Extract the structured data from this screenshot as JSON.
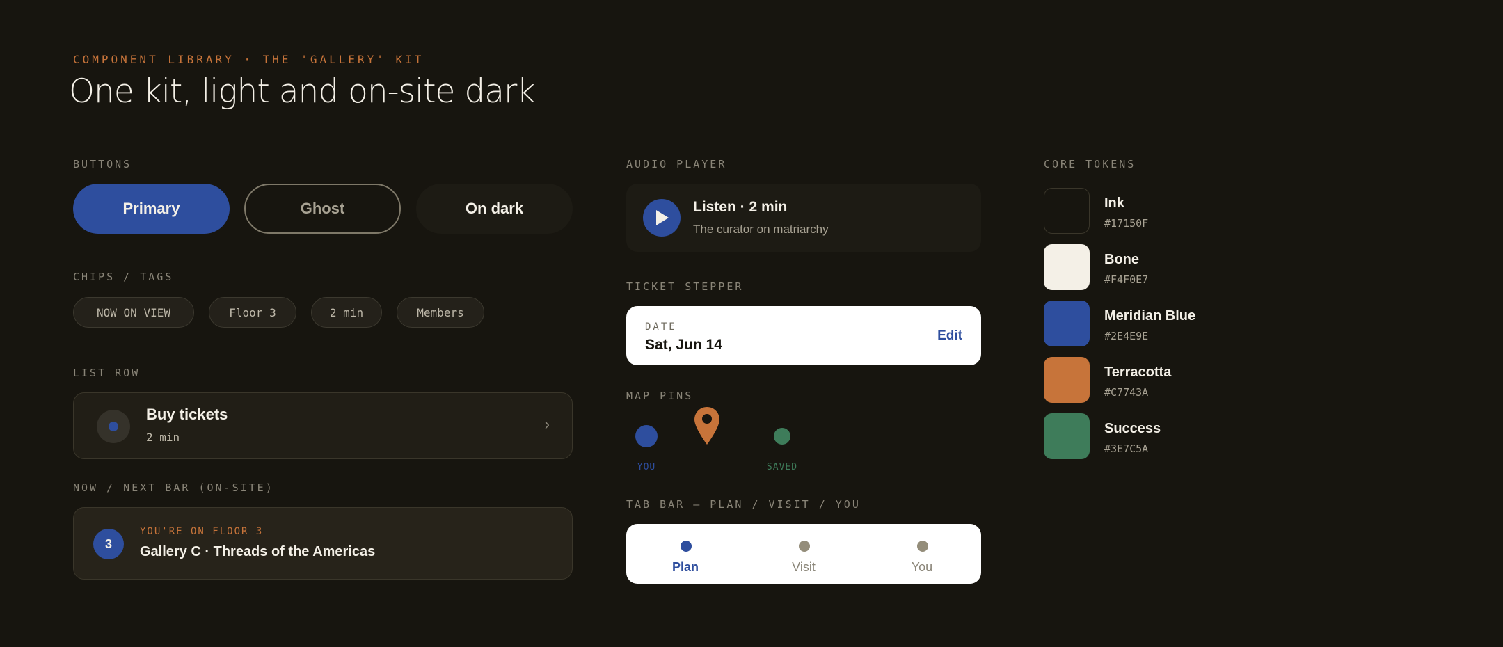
{
  "header": {
    "eyebrow": "COMPONENT LIBRARY · THE 'GALLERY' KIT",
    "title": "One kit, light and on-site dark"
  },
  "sections": {
    "buttons": "BUTTONS",
    "chips": "CHIPS / TAGS",
    "list_row": "LIST ROW",
    "now_next": "NOW / NEXT BAR (ON-SITE)",
    "audio_player": "AUDIO PLAYER",
    "ticket_stepper": "TICKET STEPPER",
    "map_pins": "MAP PINS",
    "tab_bar": "TAB BAR — PLAN / VISIT / YOU",
    "core_tokens": "CORE TOKENS"
  },
  "buttons": {
    "primary": "Primary",
    "ghost": "Ghost",
    "on_dark": "On dark"
  },
  "chips": [
    "NOW ON VIEW",
    "Floor 3",
    "2 min",
    "Members"
  ],
  "list_row": {
    "title": "Buy tickets",
    "subtitle": "2 min",
    "chevron": "›"
  },
  "now_bar": {
    "badge": "3",
    "eyebrow": "YOU'RE ON FLOOR 3",
    "title": "Gallery C · Threads of the Americas"
  },
  "player": {
    "title": "Listen · 2 min",
    "subtitle": "The curator on matriarchy",
    "icon": "play-icon"
  },
  "stepper": {
    "label": "DATE",
    "value": "Sat, Jun 14",
    "action": "Edit"
  },
  "map_pins": {
    "you_label": "YOU",
    "saved_label": "SAVED"
  },
  "tabs": [
    {
      "label": "Plan",
      "active": true
    },
    {
      "label": "Visit",
      "active": false
    },
    {
      "label": "You",
      "active": false
    }
  ],
  "tokens": [
    {
      "name": "Ink",
      "hex": "#17150F"
    },
    {
      "name": "Bone",
      "hex": "#F4F0E7"
    },
    {
      "name": "Meridian Blue",
      "hex": "#2E4E9E"
    },
    {
      "name": "Terracotta",
      "hex": "#C7743A"
    },
    {
      "name": "Success",
      "hex": "#3E7C5A"
    }
  ],
  "colors": {
    "ink": "#17150F",
    "bone": "#F4F0E7",
    "accent": "#2E4E9E",
    "terracotta": "#C7743A",
    "success": "#3E7C5A"
  }
}
